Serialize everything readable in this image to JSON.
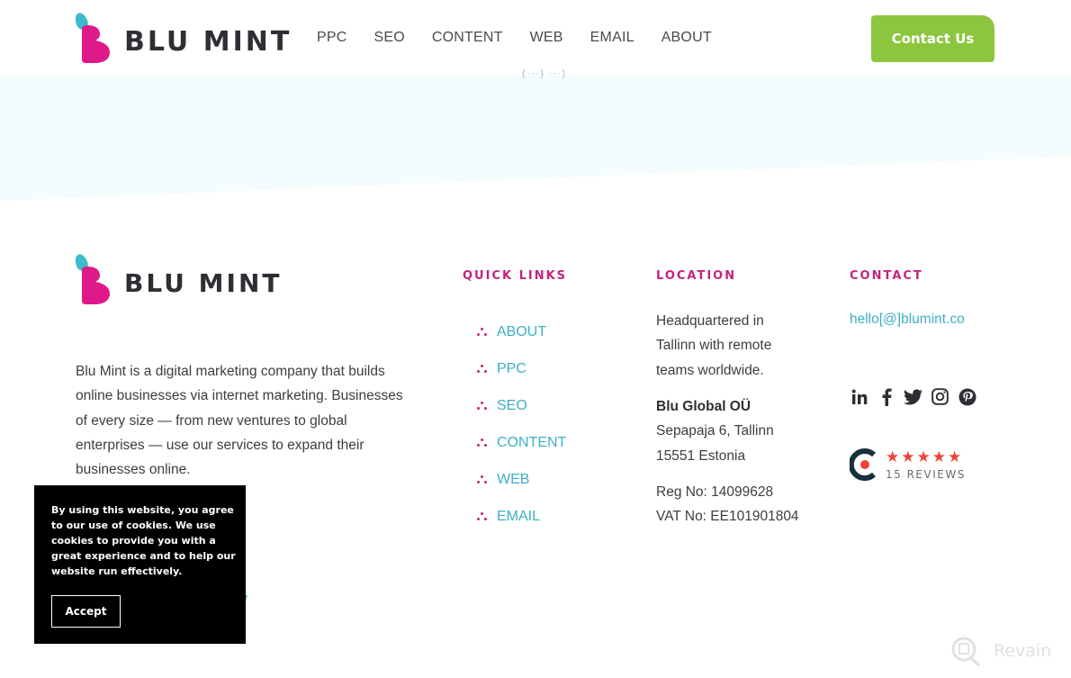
{
  "header": {
    "logo_text": "BLU MINT",
    "nav": [
      "PPC",
      "SEO",
      "CONTENT",
      "WEB",
      "EMAIL",
      "ABOUT"
    ],
    "contact_button": "Contact Us",
    "peek_text": "(···) ···)"
  },
  "colors": {
    "brand_magenta": "#e0198a",
    "brand_teal": "#3bbccb",
    "accent_green": "#8cc63f",
    "heading_pink": "#c4237f",
    "link_teal": "#3bb0c4",
    "star_red": "#ef4335"
  },
  "footer": {
    "logo_text": "BLU MINT",
    "about": "Blu Mint is a digital marketing company that builds online businesses via internet marketing. Businesses of every size — from new ventures to global enterprises — use our services to expand their businesses online.",
    "quick_links": {
      "title": "QUICK LINKS",
      "items": [
        "ABOUT",
        "PPC",
        "SEO",
        "CONTENT",
        "WEB",
        "EMAIL"
      ]
    },
    "location": {
      "title": "LOCATION",
      "hq_lines": [
        "Headquartered in",
        "Tallinn with remote",
        "teams worldwide."
      ],
      "company": "Blu Global OÜ",
      "address_lines": [
        "Sepapaja 6, Tallinn",
        "15551 Estonia"
      ],
      "reg_no": "Reg No: 14099628",
      "vat_no": "VAT No: EE101901804"
    },
    "contact": {
      "title": "CONTACT",
      "email": "hello[@]blumint.co",
      "social_icons": [
        "linkedin-icon",
        "facebook-icon",
        "twitter-icon",
        "instagram-icon",
        "pinterest-icon"
      ],
      "clutch_rating": 5,
      "clutch_reviews": "15 REVIEWS"
    },
    "privacy_peek": "cy"
  },
  "cookie": {
    "text": "By using this website, you agree to our use of cookies. We use cookies to provide you with a great experience and to help our website run effectively.",
    "accept": "Accept"
  },
  "watermark": {
    "label": "Revain"
  }
}
